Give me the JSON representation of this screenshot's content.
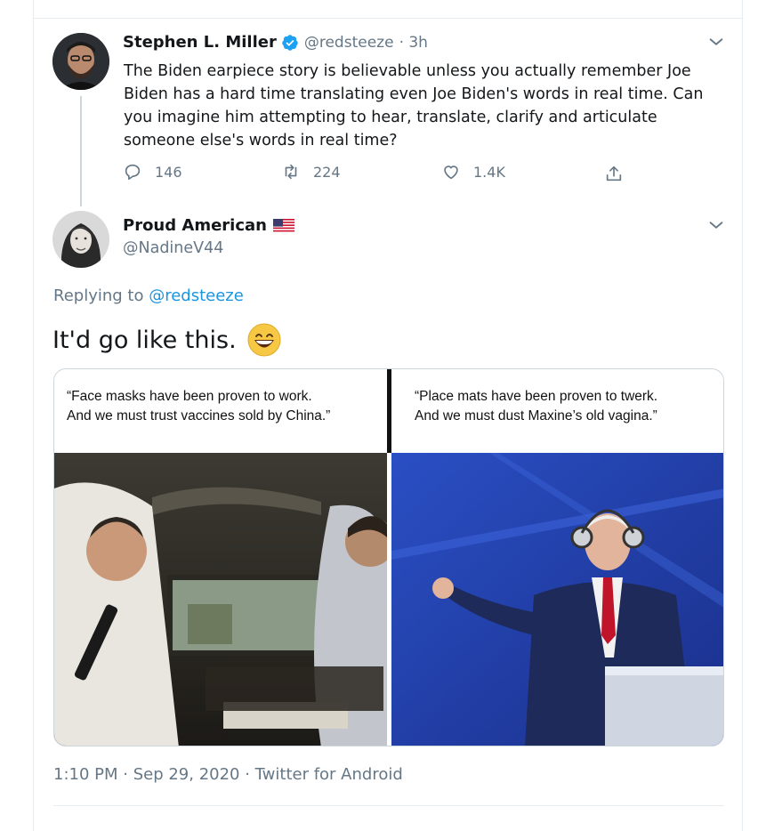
{
  "parent_tweet": {
    "author_name": "Stephen L. Miller",
    "handle": "@redsteeze",
    "time": "· 3h",
    "text": "The Biden earpiece story is believable unless you actually remember Joe Biden has a hard time translating even Joe Biden's words in real time. Can you imagine him attempting to hear, translate, clarify and articulate someone else's words in real time?",
    "actions": {
      "replies": "146",
      "retweets": "224",
      "likes": "1.4K"
    }
  },
  "main_tweet": {
    "author_name": "Proud American",
    "author_flag_icon": "us-flag-icon",
    "handle": "@NadineV44",
    "replying_prefix": "Replying to",
    "replying_to": "@redsteeze",
    "text": "It'd go like this.",
    "emoji_icon": "grinning-face-emoji",
    "media": {
      "left_caption_line1": "“Face masks have been proven to work.",
      "left_caption_line2": "And we must trust vaccines sold by China.”",
      "right_caption_line1": "“Place mats have been proven to twerk.",
      "right_caption_line2": "And we must dust Maxine’s old vagina.”"
    },
    "timestamp": "1:10 PM · Sep 29, 2020 · Twitter for Android"
  },
  "colors": {
    "text_primary": "#14171a",
    "text_secondary": "#657786",
    "link": "#1b95e0",
    "verified": "#1da1f2",
    "border": "#e6ecf0"
  }
}
